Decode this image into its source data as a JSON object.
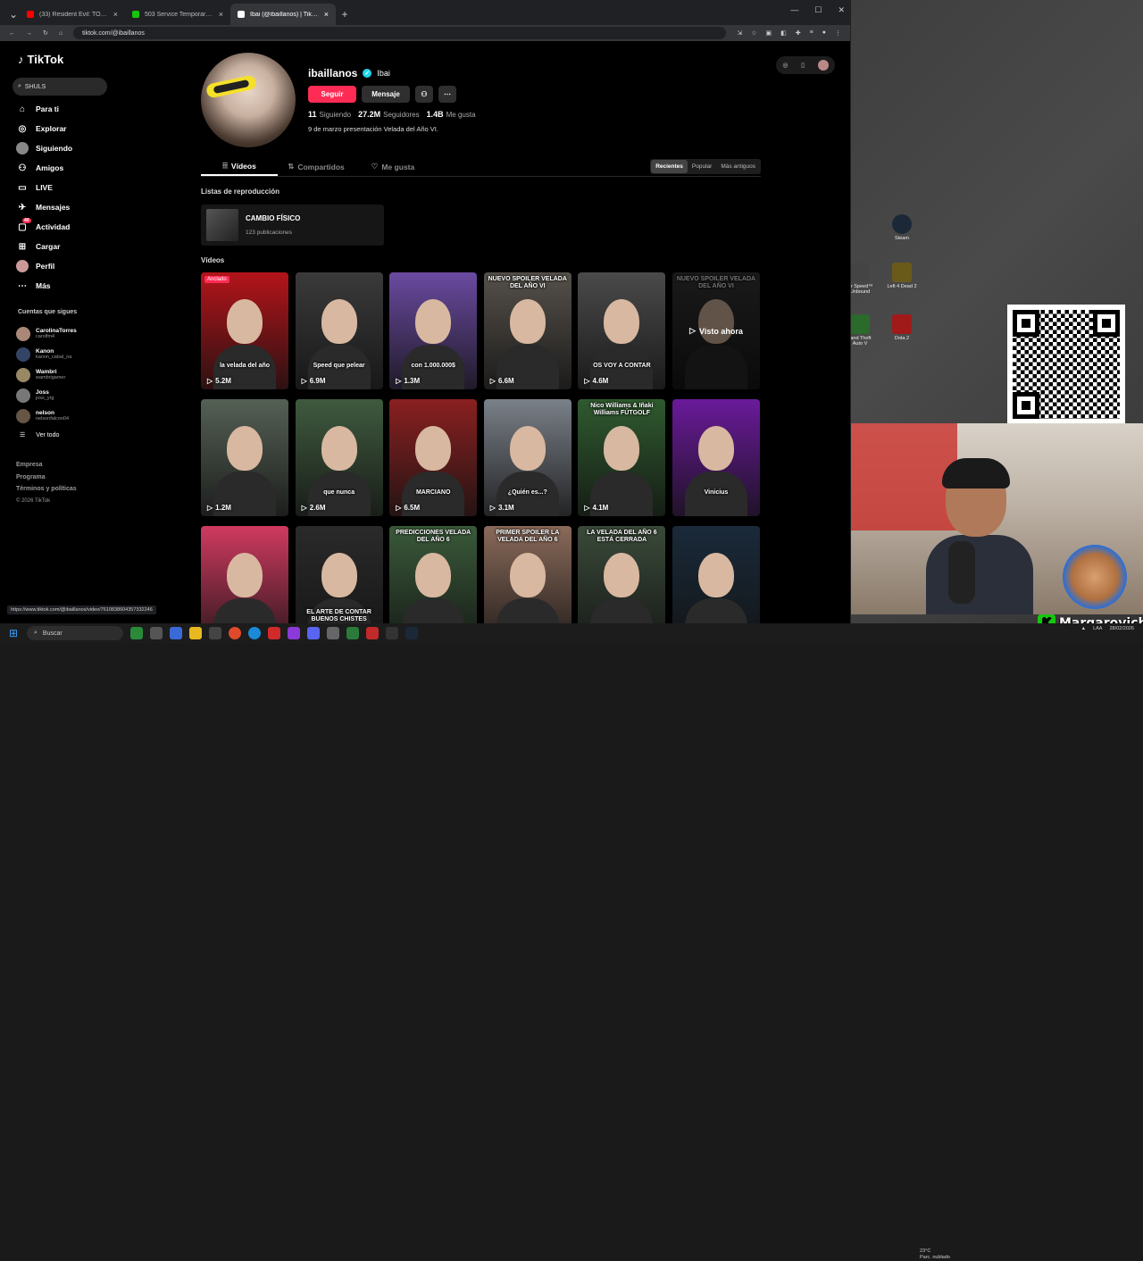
{
  "browser": {
    "tabs": [
      {
        "title": "(33) Resident Evil: TODA La Sag",
        "color": "#ff0000"
      },
      {
        "title": "503 Service Temporarily Unava",
        "color": "#16c60c"
      },
      {
        "title": "Ibai (@ibaillanos) | TikTok",
        "color": "#ffffff"
      }
    ],
    "url": "tiktok.com/@ibaillanos",
    "status_url": "https://www.tiktok.com/@ibaillanos/video/7610838604357332246"
  },
  "sidebar": {
    "logo": "TikTok",
    "search_value": "SHULS",
    "nav": [
      {
        "label": "Para ti",
        "icon": "home-icon"
      },
      {
        "label": "Explorar",
        "icon": "compass-icon"
      },
      {
        "label": "Siguiendo",
        "icon": "following-icon"
      },
      {
        "label": "Amigos",
        "icon": "friends-icon"
      },
      {
        "label": "LIVE",
        "icon": "live-icon"
      },
      {
        "label": "Mensajes",
        "icon": "messages-icon"
      },
      {
        "label": "Actividad",
        "icon": "activity-icon",
        "badge": "40"
      },
      {
        "label": "Cargar",
        "icon": "upload-icon"
      },
      {
        "label": "Perfil",
        "icon": "profile-icon"
      },
      {
        "label": "Más",
        "icon": "more-icon"
      }
    ],
    "following_title": "Cuentas que sigues",
    "following": [
      {
        "name": "CarolinaTorres",
        "handle": "carolfm4"
      },
      {
        "name": "Kanon",
        "handle": "kanon_cabal_na"
      },
      {
        "name": "Wambri",
        "handle": "wambrigamer"
      },
      {
        "name": "Joss",
        "handle": "joss_yrg"
      },
      {
        "name": "nelson",
        "handle": "nelsonfalcon04"
      }
    ],
    "see_all": "Ver todo",
    "footer": [
      "Empresa",
      "Programa",
      "Términos y políticas"
    ],
    "copyright": "© 2026 TikTok"
  },
  "profile": {
    "username": "ibaillanos",
    "nickname": "Ibai",
    "follow_label": "Seguir",
    "message_label": "Mensaje",
    "following_count": "11",
    "following_label": "Siguiendo",
    "followers_count": "27.2M",
    "followers_label": "Seguidores",
    "likes_count": "1.4B",
    "likes_label": "Me gusta",
    "bio": "9 de marzo presentación Velada del Año VI."
  },
  "tabs": [
    "Vídeos",
    "Compartidos",
    "Me gusta"
  ],
  "sort": [
    "Recientes",
    "Popular",
    "Más antiguos"
  ],
  "playlists_title": "Listas de reproducción",
  "playlist": {
    "title": "CAMBIO FÍSICO",
    "count": "123 publicaciones"
  },
  "videos_title": "Vídeos",
  "videos": [
    {
      "views": "5.2M",
      "caption": "la velada del año",
      "pinned": "Anclado",
      "bg": "#b3141a"
    },
    {
      "views": "6.9M",
      "caption": "Speed que pelear",
      "bg": "#3a3a3a"
    },
    {
      "views": "1.3M",
      "caption": "con 1.000.000$",
      "bg": "#6a4aa0"
    },
    {
      "views": "6.6M",
      "caption": "NUEVO SPOILER VELADA DEL AÑO VI",
      "bg": "#55504a"
    },
    {
      "views": "4.6M",
      "caption": "OS VOY A CONTAR",
      "bg": "#4a4a4a"
    },
    {
      "views": "",
      "caption": "NUEVO SPOILER VELADA DEL AÑO VI",
      "overlay": "Visto ahora",
      "bg": "#3a3a3a"
    },
    {
      "views": "1.2M",
      "caption": "",
      "bg": "#556055"
    },
    {
      "views": "2.6M",
      "caption": "que nunca",
      "bg": "#3f5a3f"
    },
    {
      "views": "6.5M",
      "caption": "MARCIANO",
      "bg": "#8a2020"
    },
    {
      "views": "3.1M",
      "caption": "¿Quién es...?",
      "bg": "#7a8088"
    },
    {
      "views": "4.1M",
      "caption": "Nico Williams & Iñaki Williams FÚTGOLF",
      "bg": "#2f5a2f"
    },
    {
      "views": "",
      "caption": "Vinicius",
      "bg": "#6a1a9a"
    },
    {
      "views": "",
      "caption": "",
      "bg": "#d03a60"
    },
    {
      "views": "",
      "caption": "EL ARTE DE CONTAR BUENOS CHISTES",
      "bg": "#2a2a2a"
    },
    {
      "views": "",
      "caption": "PREDICCIONES VELADA DEL AÑO 6",
      "bg": "#3a5a3a"
    },
    {
      "views": "",
      "caption": "PRIMER SPOILER LA VELADA DEL AÑO 6",
      "bg": "#8a6a5a"
    },
    {
      "views": "",
      "caption": "LA VELADA DEL AÑO 6 ESTÁ CERRADA",
      "bg": "#3a4a3a"
    },
    {
      "views": "",
      "caption": "",
      "bg": "#1a2a3a"
    }
  ],
  "desktop": {
    "icons": [
      {
        "label": "Steam",
        "color": "#1b2838"
      },
      {
        "label": "for Speed™ Unbound",
        "color": "#444"
      },
      {
        "label": "Left 4 Dead 2",
        "color": "#6a5a1a"
      },
      {
        "label": "rand Theft Auto V",
        "color": "#2a6a2a"
      },
      {
        "label": "Dota 2",
        "color": "#a01a1a"
      }
    ]
  },
  "brand": "Margarovich",
  "taskbar": {
    "search": "Buscar",
    "weather_temp": "23°C",
    "weather_desc": "Parc. nublado",
    "lang": "LAA",
    "date": "28/02/2026"
  }
}
